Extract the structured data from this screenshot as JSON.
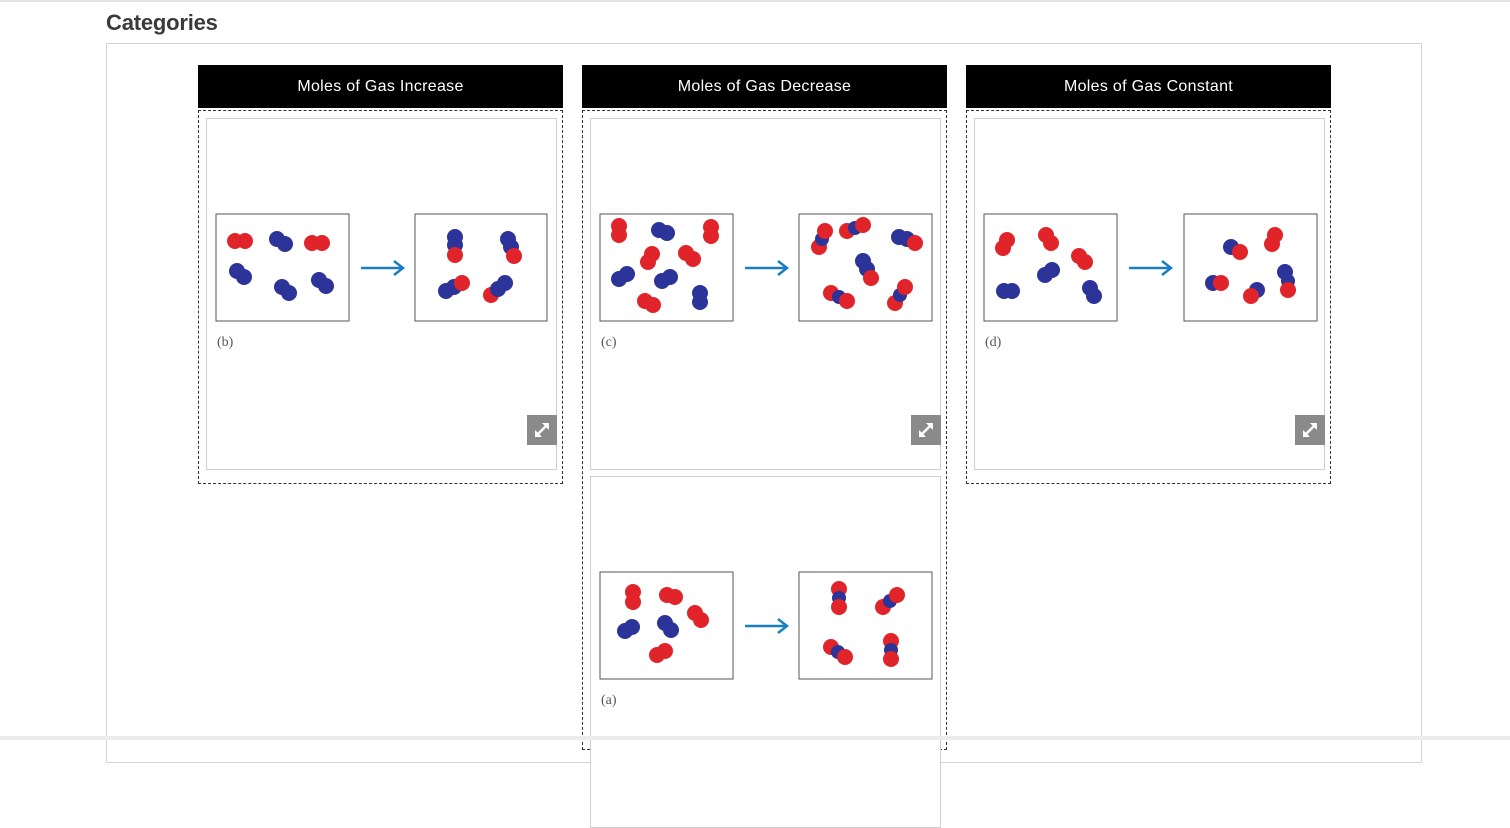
{
  "page": {
    "title": "Categories"
  },
  "colors": {
    "oxygen": "#e0242a",
    "nitrogen": "#2c3399",
    "arrow": "#1a7fc1",
    "header_bg": "#000000"
  },
  "categories": [
    {
      "label": "Moles of Gas Increase",
      "cards": [
        {
          "label": "(b)",
          "icon": "expand-icon"
        }
      ]
    },
    {
      "label": "Moles of Gas Decrease",
      "cards": [
        {
          "label": "(c)",
          "icon": "expand-icon"
        },
        {
          "label": "(a)",
          "icon": "expand-icon"
        }
      ]
    },
    {
      "label": "Moles of Gas Constant",
      "cards": [
        {
          "label": "(d)",
          "icon": "expand-icon"
        }
      ]
    }
  ]
}
